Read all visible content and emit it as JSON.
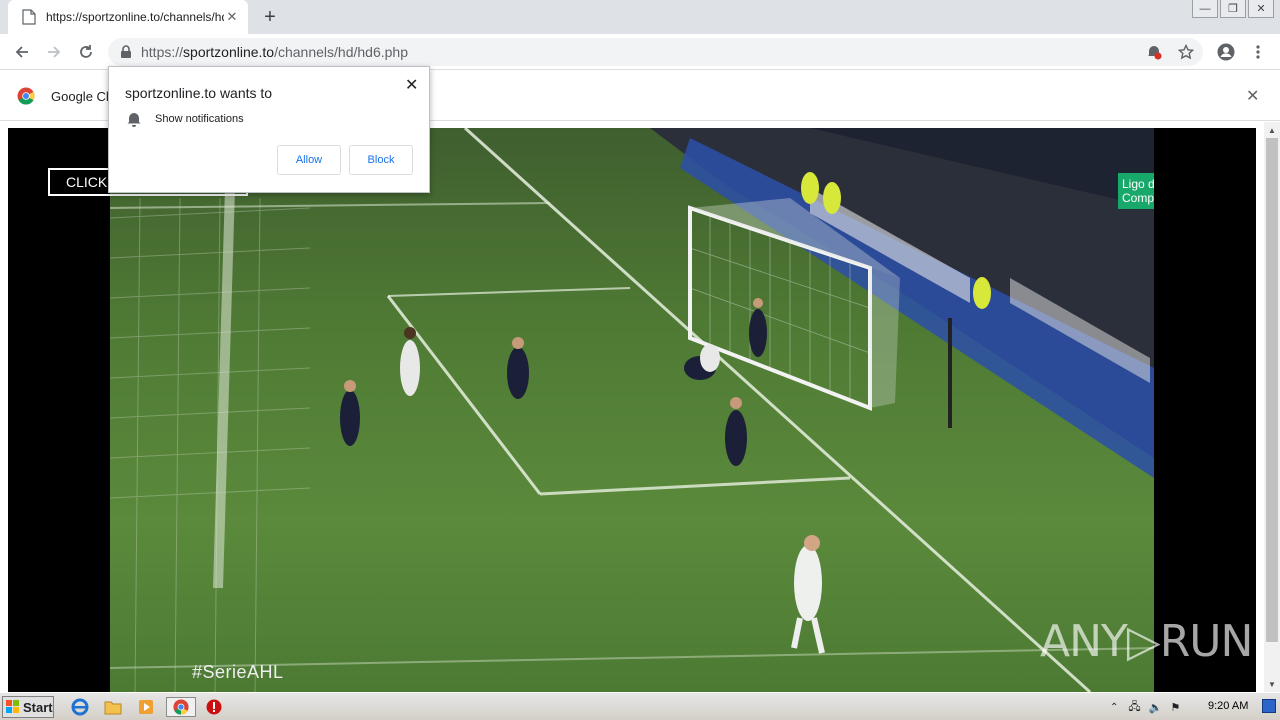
{
  "browser": {
    "tab_title": "https://sportzonline.to/channels/hd/",
    "tab_close": "✕",
    "new_tab": "+",
    "window_controls": [
      "—",
      "❐",
      "✕"
    ],
    "url_scheme": "https://",
    "url_host": "sportzonline.to",
    "url_path": "/channels/hd/hd6.php"
  },
  "infobar": {
    "text": "Google Ch",
    "close": "✕"
  },
  "permission_popup": {
    "title": "sportzonline.to wants to",
    "item": "Show notifications",
    "allow_label": "Allow",
    "block_label": "Block",
    "close": "✕"
  },
  "page": {
    "click_button": "CLICK",
    "hashtag": "#SerieAHL",
    "watermark": "ANY▷RUN",
    "league_badge": "Ligo de Compeones"
  },
  "taskbar": {
    "start_label": "Start",
    "clock": "9:20 AM"
  },
  "colors": {
    "accent_blue": "#1a73e8",
    "field_green": "#5b8a3c",
    "badge_green": "#19a86b"
  }
}
